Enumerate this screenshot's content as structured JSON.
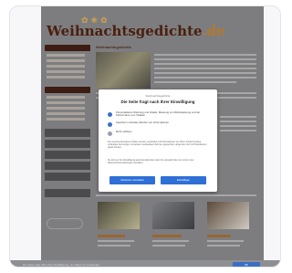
{
  "site": {
    "logo_text": "Weihnachtsgedichte",
    "logo_tld": ".de",
    "logo_decoration": "✿❀✿",
    "content_title": "Weihnachtsgedichte",
    "thumbnails": [
      {
        "colors": [
          "#4a4838",
          "#b5b08f"
        ]
      },
      {
        "colors": [
          "#7c7e82",
          "#3a3c3f"
        ]
      },
      {
        "colors": [
          "#5c4a3c",
          "#cfcac1"
        ]
      }
    ]
  },
  "consent": {
    "brand": "Weihnachtsgedichte",
    "title": "Die Seite fragt nach Ihrer Einwilligung",
    "options": [
      {
        "icon": "user-icon",
        "text": "Personalisierte Werbung und Inhalte, Messung von Werbeleistung und der Performance von Inhalten"
      },
      {
        "icon": "device-icon",
        "text": "Speichern und/oder Abrufen von Informationen"
      },
      {
        "icon": "more-icon",
        "text": "Mehr erfahren"
      }
    ],
    "paragraph_1": "Ihre personenbezogenen Daten werden verarbeitet und Informationen von Ihrem Gerät (Cookies, eindeutige Kennungen und andere Gerätedaten) können gespeichert, abgerufen und mit Drittanbietern geteilt werden.",
    "paragraph_2": "Sie können Ihre Einwilligung jederzeit widerrufen oder Ihre Auswahl über den Link zu den Datenschutzeinstellungen verwalten.",
    "manage_label": "Optionen verwalten",
    "accept_label": "Einwilligen",
    "accent_color": "#2f6fd6"
  },
  "footer": {
    "text": "Die Seite fragt nach Ihrer Einwilligung, um Daten zu verwenden",
    "button_label": "OK"
  }
}
